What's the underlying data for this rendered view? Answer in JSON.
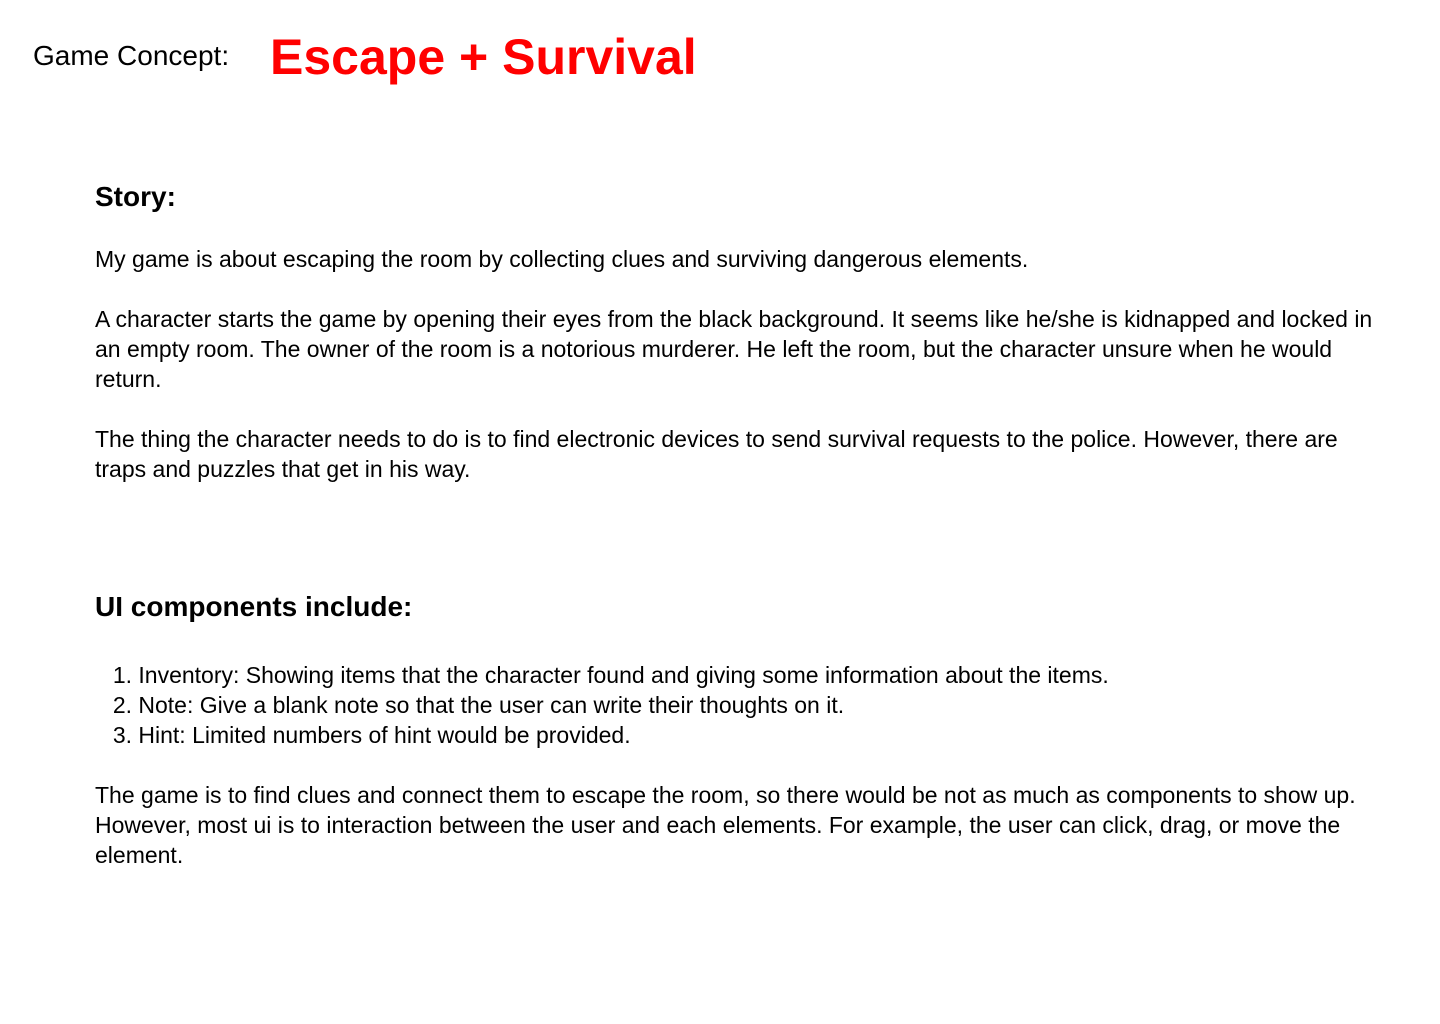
{
  "header": {
    "label": "Game Concept:",
    "title": "Escape + Survival"
  },
  "story": {
    "heading": "Story:",
    "paragraphs": [
      "My game is about escaping the room by collecting clues and surviving dangerous elements.",
      "A character starts the game by opening their eyes from the black background. It seems like he/she is kidnapped and locked in an empty room. The owner of the room is a notorious murderer. He left the room, but the character unsure when he would return.",
      "The thing the character needs to do is to find electronic devices to send survival requests to the police. However, there are traps and puzzles that get in his way."
    ]
  },
  "ui_components": {
    "heading": "UI components include:",
    "items": [
      {
        "number": "1.",
        "text": "Inventory: Showing items that the character found and giving some information about the items."
      },
      {
        "number": "2.",
        "text": "Note: Give a blank note so that the user can write their thoughts on it."
      },
      {
        "number": "3.",
        "text": "Hint: Limited numbers of hint would be provided."
      }
    ],
    "paragraph": "The game is to find clues and connect them to escape the room, so there would be not as much as components to show up. However, most ui is to interaction between the user and each elements. For example, the user can click, drag, or move the element."
  },
  "colors": {
    "title": "#ff0000",
    "text": "#000000",
    "background": "#ffffff"
  }
}
